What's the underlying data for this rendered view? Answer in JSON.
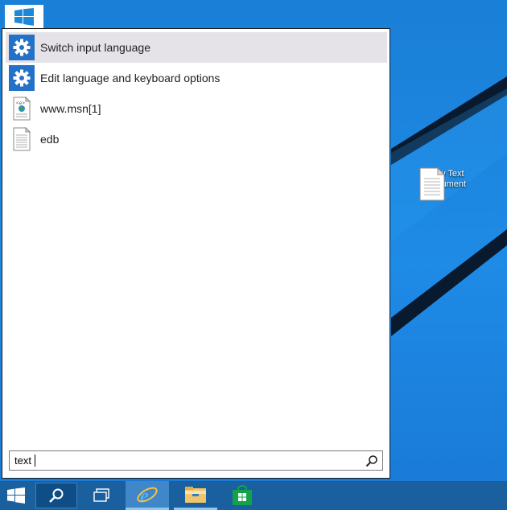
{
  "search_results": [
    {
      "label": "Switch input language",
      "icon": "gear-icon",
      "selected": true
    },
    {
      "label": "Edit language and keyboard options",
      "icon": "gear-icon",
      "selected": false
    },
    {
      "label": "www.msn[1]",
      "icon": "web-document-icon",
      "selected": false
    },
    {
      "label": "edb",
      "icon": "text-file-icon",
      "selected": false
    }
  ],
  "search": {
    "value": "text"
  },
  "desktop": {
    "icon_label": "New Text Document"
  },
  "taskbar": {
    "items": [
      "start-button",
      "search-button",
      "task-view-button",
      "internet-explorer",
      "file-explorer",
      "store"
    ]
  },
  "colors": {
    "accent": "#2472c8",
    "taskbar": "#1a5f9e",
    "desktop": "#1e8be6",
    "selection": "#e5e3e8"
  }
}
